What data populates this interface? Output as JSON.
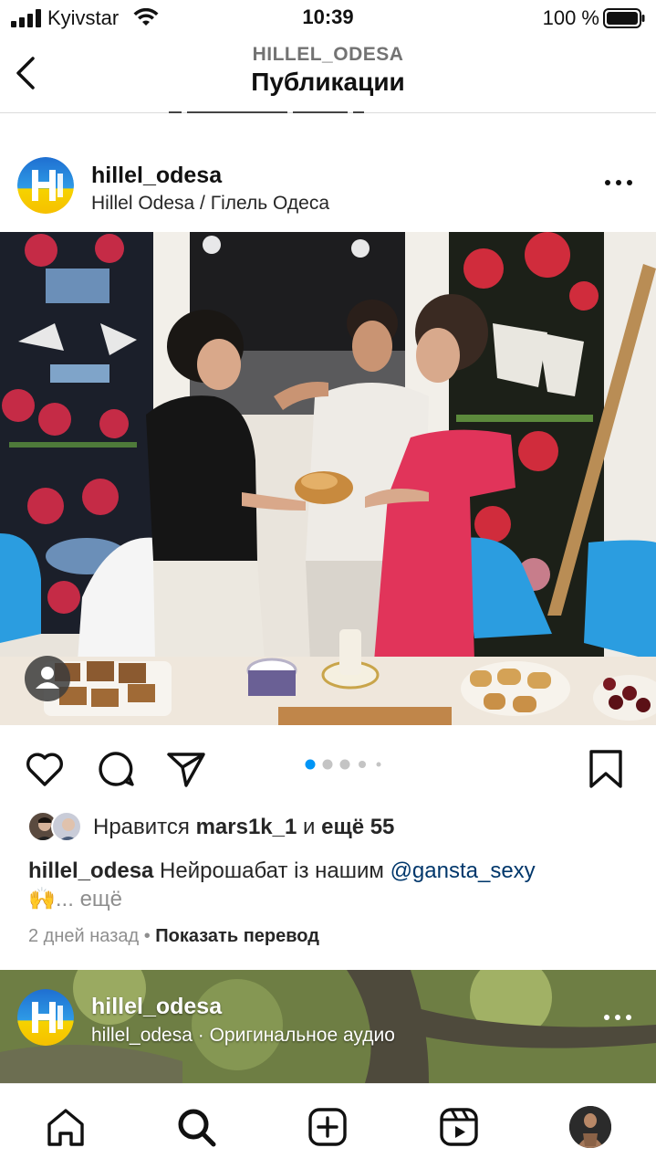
{
  "status_bar": {
    "carrier": "Kyivstar",
    "time": "10:39",
    "battery_text": "100 %"
  },
  "header": {
    "account": "HILLEL_ODESA",
    "title": "Публикации"
  },
  "post": {
    "username": "hillel_odesa",
    "subtitle": "Hillel Odesa / Гілель Одеса",
    "image_count_dots": 5,
    "active_dot": 1,
    "likes_prefix": "Нравится ",
    "likes_user": "mars1k_1",
    "likes_middle": " и ",
    "likes_rest": "ещё 55",
    "caption_user": "hillel_odesa",
    "caption_text": " Нейрошабат із нашим ",
    "caption_mention": "@gansta_sexy",
    "caption_emoji": "🙌",
    "caption_more": "... ещё",
    "time_ago": "2 дней назад",
    "separator": " • ",
    "translate_label": "Показать перевод"
  },
  "next_post": {
    "username": "hillel_odesa",
    "audio": "hillel_odesa · Оригинальное аудио"
  },
  "colors": {
    "accent_blue": "#0095f6",
    "mention": "#00376b",
    "muted": "#8e8e8e"
  },
  "icons": [
    "signal-icon",
    "wifi-icon",
    "battery-icon",
    "back-chevron-icon",
    "more-icon",
    "user-tag-icon",
    "heart-icon",
    "comment-icon",
    "share-icon",
    "bookmark-icon",
    "home-icon",
    "search-icon",
    "create-icon",
    "reels-icon"
  ]
}
